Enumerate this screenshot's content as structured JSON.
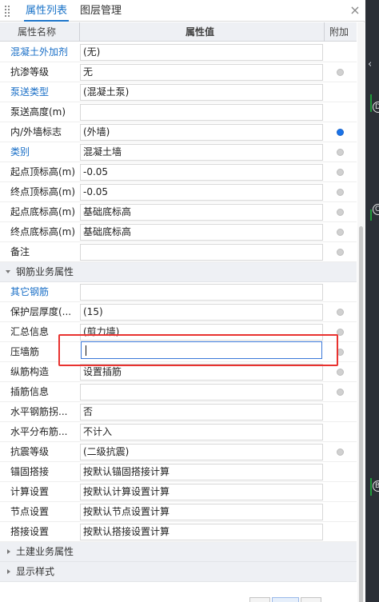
{
  "tabs": [
    {
      "label": "属性列表",
      "active": true
    },
    {
      "label": "图层管理",
      "active": false
    }
  ],
  "header": {
    "name": "属性名称",
    "value": "属性值",
    "add": "附加"
  },
  "rows": [
    {
      "name": "混凝土外加剂",
      "value": "(无)",
      "blue": true,
      "add": null
    },
    {
      "name": "抗渗等级",
      "value": "无",
      "blue": false,
      "add": "off"
    },
    {
      "name": "泵送类型",
      "value": "(混凝土泵)",
      "blue": true,
      "add": null
    },
    {
      "name": "泵送高度(m)",
      "value": "",
      "blue": false,
      "add": null
    },
    {
      "name": "内/外墙标志",
      "value": "(外墙)",
      "blue": false,
      "add": "on"
    },
    {
      "name": "类别",
      "value": "混凝土墙",
      "blue": true,
      "add": "off"
    },
    {
      "name": "起点顶标高(m)",
      "value": "-0.05",
      "blue": false,
      "add": "off"
    },
    {
      "name": "终点顶标高(m)",
      "value": "-0.05",
      "blue": false,
      "add": "off"
    },
    {
      "name": "起点底标高(m)",
      "value": "基础底标高",
      "blue": false,
      "add": "off"
    },
    {
      "name": "终点底标高(m)",
      "value": "基础底标高",
      "blue": false,
      "add": "off"
    },
    {
      "name": "备注",
      "value": "",
      "blue": false,
      "add": "off"
    },
    {
      "group": "钢筋业务属性",
      "expanded": true
    },
    {
      "name": "其它钢筋",
      "value": "",
      "blue": true,
      "add": null
    },
    {
      "name": "保护层厚度(...",
      "value": "(15)",
      "blue": false,
      "add": "off"
    },
    {
      "name": "汇总信息",
      "value": "(剪力墙)",
      "blue": false,
      "add": "off"
    },
    {
      "name": "压墙筋",
      "value": "",
      "blue": false,
      "add": "off",
      "editing": true
    },
    {
      "name": "纵筋构造",
      "value": "设置插筋",
      "blue": false,
      "add": "off"
    },
    {
      "name": "插筋信息",
      "value": "",
      "blue": false,
      "add": "off"
    },
    {
      "name": "水平钢筋拐...",
      "value": "否",
      "blue": false,
      "add": null
    },
    {
      "name": "水平分布筋...",
      "value": "不计入",
      "blue": false,
      "add": null
    },
    {
      "name": "抗震等级",
      "value": "(二级抗震)",
      "blue": false,
      "add": "off"
    },
    {
      "name": "锚固搭接",
      "value": "按默认锚固搭接计算",
      "blue": false,
      "add": null
    },
    {
      "name": "计算设置",
      "value": "按默认计算设置计算",
      "blue": false,
      "add": null
    },
    {
      "name": "节点设置",
      "value": "按默认节点设置计算",
      "blue": false,
      "add": null
    },
    {
      "name": "搭接设置",
      "value": "按默认搭接设置计算",
      "blue": false,
      "add": null
    },
    {
      "group": "土建业务属性",
      "expanded": false
    },
    {
      "group": "显示样式",
      "expanded": false
    }
  ],
  "canvas_strip": {
    "markers": [
      "D",
      "C",
      "B"
    ]
  },
  "icons": {
    "grip": "drag-grip-icon",
    "close": "close-icon",
    "expanded": "caret-down-icon",
    "collapsed": "caret-right-icon",
    "add_off": "radio-off-icon",
    "add_on": "radio-on-icon",
    "strip_arrow": "chevron-left-icon"
  },
  "colors": {
    "accent": "#1a73c8",
    "blue_label": "#1a6fc7",
    "highlight": "#e8322f",
    "group_bg": "#eef0f4",
    "dot_on": "#1a73e8",
    "axis_line": "#1f9a3a"
  }
}
